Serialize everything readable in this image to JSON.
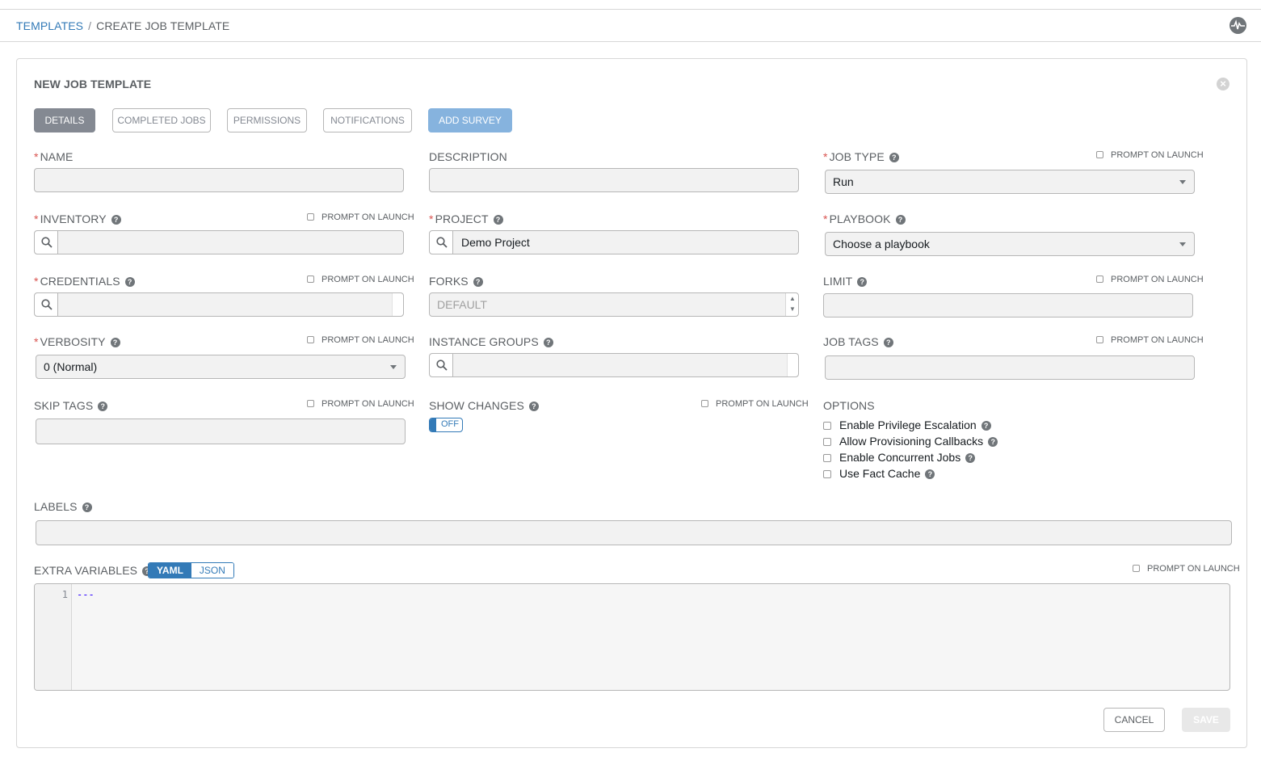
{
  "breadcrumb": {
    "parent": "TEMPLATES",
    "separator": "/",
    "current": "CREATE JOB TEMPLATE"
  },
  "panel": {
    "title": "NEW JOB TEMPLATE",
    "close_glyph": "×"
  },
  "tabs": [
    "DETAILS",
    "COMPLETED JOBS",
    "PERMISSIONS",
    "NOTIFICATIONS",
    "ADD SURVEY"
  ],
  "prompt_on_launch": "PROMPT ON LAUNCH",
  "help_glyph": "?",
  "required_mark": "*",
  "fields": {
    "name": {
      "label": "NAME",
      "value": ""
    },
    "description": {
      "label": "DESCRIPTION",
      "value": ""
    },
    "job_type": {
      "label": "JOB TYPE",
      "value": "Run"
    },
    "inventory": {
      "label": "INVENTORY",
      "value": ""
    },
    "project": {
      "label": "PROJECT",
      "value": "Demo Project"
    },
    "playbook": {
      "label": "PLAYBOOK",
      "value": "Choose a playbook"
    },
    "credentials": {
      "label": "CREDENTIALS",
      "value": ""
    },
    "forks": {
      "label": "FORKS",
      "placeholder": "DEFAULT"
    },
    "limit": {
      "label": "LIMIT",
      "value": ""
    },
    "verbosity": {
      "label": "VERBOSITY",
      "value": "0 (Normal)"
    },
    "instance_groups": {
      "label": "INSTANCE GROUPS",
      "value": ""
    },
    "job_tags": {
      "label": "JOB TAGS",
      "value": ""
    },
    "skip_tags": {
      "label": "SKIP TAGS",
      "value": ""
    },
    "show_changes": {
      "label": "SHOW CHANGES",
      "toggle": "OFF",
      "enabled": false
    },
    "options": {
      "label": "OPTIONS",
      "items": [
        "Enable Privilege Escalation",
        "Allow Provisioning Callbacks",
        "Enable Concurrent Jobs",
        "Use Fact Cache"
      ]
    },
    "labels": {
      "label": "LABELS",
      "value": ""
    },
    "extra_variables": {
      "label": "EXTRA VARIABLES",
      "modes": [
        "YAML",
        "JSON"
      ],
      "active_mode": "YAML",
      "line_number": "1",
      "code": "---"
    }
  },
  "actions": {
    "cancel": "CANCEL",
    "save": "SAVE"
  },
  "colors": {
    "accent": "#337ab7",
    "required": "#d9534f",
    "survey": "#86b3de",
    "active_tab": "#848992"
  }
}
